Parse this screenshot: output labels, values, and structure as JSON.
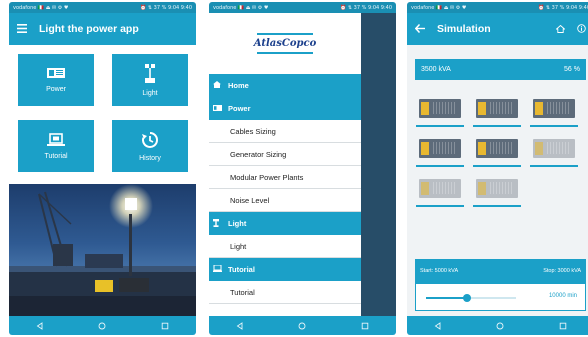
{
  "colors": {
    "primary": "#1ba0c8",
    "status": "#1a8fb3",
    "genYellow": "#e8b830",
    "genDark": "#5d6b7a",
    "genGrey": "#b9bec4"
  },
  "status_bar": {
    "left": "vodafone 🇮🇹 ⏏ ✉ ⚙ ♥",
    "right": "⏰ ⇅ 37 % 9:04 9:40"
  },
  "screen1": {
    "title": "Light the power app",
    "tiles": [
      {
        "label": "Power",
        "icon": "generator-icon"
      },
      {
        "label": "Light",
        "icon": "light-tower-icon"
      },
      {
        "label": "Tutorial",
        "icon": "laptop-icon"
      },
      {
        "label": "History",
        "icon": "history-icon"
      }
    ]
  },
  "screen2": {
    "logo": "AtlasCopco",
    "menu": [
      {
        "type": "section",
        "label": "Home",
        "icon": "home-icon"
      },
      {
        "type": "section",
        "label": "Power",
        "icon": "generator-icon"
      },
      {
        "type": "item",
        "label": "Cables Sizing"
      },
      {
        "type": "item",
        "label": "Generator Sizing"
      },
      {
        "type": "item",
        "label": "Modular Power Plants"
      },
      {
        "type": "item",
        "label": "Noise Level"
      },
      {
        "type": "section",
        "label": "Light",
        "icon": "light-tower-icon"
      },
      {
        "type": "item",
        "label": "Light"
      },
      {
        "type": "section",
        "label": "Tutorial",
        "icon": "tutorial-icon"
      },
      {
        "type": "item",
        "label": "Tutorial"
      }
    ]
  },
  "screen3": {
    "title": "Simulation",
    "kva": "3500 kVA",
    "percent": "56 %",
    "generators": [
      "yellow",
      "yellow",
      "yellow",
      "yellow",
      "yellow",
      "grey",
      "grey",
      "grey"
    ],
    "start": "Start: 5000 kVA",
    "stop": "Stop: 3000 kVA",
    "slider_value": "10000 min",
    "slider_fraction": 0.45
  }
}
